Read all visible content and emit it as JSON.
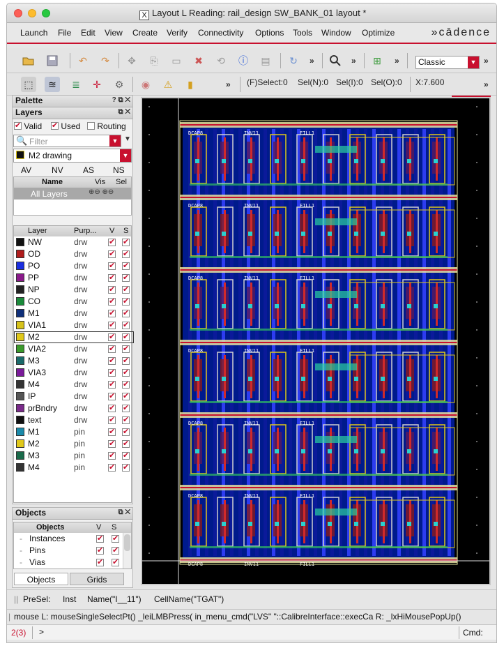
{
  "window": {
    "title": "Layout L Reading: rail_design SW_BANK_01 layout *"
  },
  "menu": [
    "Launch",
    "File",
    "Edit",
    "View",
    "Create",
    "Verify",
    "Connectivity",
    "Options",
    "Tools",
    "Window",
    "Optimize"
  ],
  "logo": "»cādence",
  "toolbar": {
    "view_mode": "Classic"
  },
  "status": {
    "select": "(F)Select:0",
    "sel_n": "Sel(N):0",
    "sel_i": "Sel(I):0",
    "sel_o": "Sel(O):0",
    "x": "X:7.600"
  },
  "palette": {
    "title": "Palette",
    "layers_title": "Layers"
  },
  "layer_filters": {
    "valid": "Valid",
    "used": "Used",
    "routing": "Routing",
    "filter_placeholder": "Filter"
  },
  "current_layer": "M2 drawing",
  "vis_tabs": [
    "AV",
    "NV",
    "AS",
    "NS"
  ],
  "layer_sets": {
    "name_header": "Name",
    "vis_header": "Vis",
    "sel_header": "Sel",
    "all_layers": "All Layers"
  },
  "layer_table": {
    "headers": [
      "Layer",
      "Purp...",
      "V",
      "S"
    ],
    "rows": [
      {
        "layer": "NW",
        "purpose": "drw",
        "color": "#111111"
      },
      {
        "layer": "OD",
        "purpose": "drw",
        "color": "#b01c1c"
      },
      {
        "layer": "PO",
        "purpose": "drw",
        "color": "#1a2ee0"
      },
      {
        "layer": "PP",
        "purpose": "drw",
        "color": "#8a1a8a"
      },
      {
        "layer": "NP",
        "purpose": "drw",
        "color": "#222222"
      },
      {
        "layer": "CO",
        "purpose": "drw",
        "color": "#1a8a3a"
      },
      {
        "layer": "M1",
        "purpose": "drw",
        "color": "#0e2f7a"
      },
      {
        "layer": "VIA1",
        "purpose": "drw",
        "color": "#d6c21a"
      },
      {
        "layer": "M2",
        "purpose": "drw",
        "color": "#e0c81a"
      },
      {
        "layer": "VIA2",
        "purpose": "drw",
        "color": "#3a9a2a"
      },
      {
        "layer": "M3",
        "purpose": "drw",
        "color": "#1a6a6a"
      },
      {
        "layer": "VIA3",
        "purpose": "drw",
        "color": "#7a1a9a"
      },
      {
        "layer": "M4",
        "purpose": "drw",
        "color": "#333333"
      },
      {
        "layer": "IP",
        "purpose": "drw",
        "color": "#555555"
      },
      {
        "layer": "prBndry",
        "purpose": "drw",
        "color": "#7a2a8a"
      },
      {
        "layer": "text",
        "purpose": "drw",
        "color": "#111111"
      },
      {
        "layer": "M1",
        "purpose": "pin",
        "color": "#1a8aaa"
      },
      {
        "layer": "M2",
        "purpose": "pin",
        "color": "#e0c81a"
      },
      {
        "layer": "M3",
        "purpose": "pin",
        "color": "#1a6a4a"
      },
      {
        "layer": "M4",
        "purpose": "pin",
        "color": "#333333"
      }
    ]
  },
  "objects": {
    "title": "Objects",
    "headers": [
      "Objects",
      "V",
      "S"
    ],
    "items": [
      "Instances",
      "Pins",
      "Vias"
    ],
    "tabs": [
      "Objects",
      "Grids"
    ]
  },
  "presel": {
    "label": "PreSel:",
    "type": "Inst",
    "name": "Name(\"I__11\")",
    "cell": "CellName(\"TGAT\")"
  },
  "mouse_line": "mouse L: mouseSingleSelectPt() _leiLMBPress( in_menu_cmd(\"LVS\" \"::CalibreInterface::execCa R: _lxHiMousePopUp()",
  "cmdline": {
    "count": "2(3)",
    "prompt": ">",
    "cmd_label": "Cmd:"
  },
  "canvas_labels": [
    "DCAP8",
    "INV11",
    "FILL1"
  ]
}
